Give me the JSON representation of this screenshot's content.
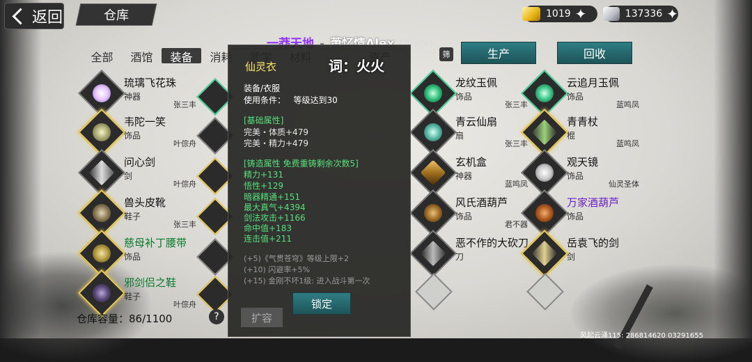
{
  "topbar": {
    "back_label": "返回",
    "title": "仓库",
    "gold": "1019",
    "silver": "137336"
  },
  "player": {
    "guild": "一莽天地",
    "dash": "-",
    "name": "萧忆情Alex",
    "alias": "(Alex)"
  },
  "tabs": [
    "全部",
    "酒馆",
    "装备",
    "消耗",
    "武学",
    "材料",
    "",
    "资产"
  ],
  "filter_icon": "筛",
  "buttons": {
    "produce": "生产",
    "recycle": "回收",
    "lock": "锁定",
    "expand": "扩容"
  },
  "ci": "词：火火",
  "capacity": {
    "label": "仓库容量：",
    "value": "86/1100"
  },
  "footer_text": "风起云涌115: 286814620 03291655",
  "tooltip": {
    "name": "仙灵衣",
    "type": "装备/衣服",
    "cond_label": "使用条件：",
    "cond_value": "等级达到30",
    "base_title": "[基础属性]",
    "base": [
      "完美・体质+479",
      "完美・精力+479"
    ],
    "forge_title": "[铸造属性  免费重铸剩余次数5]",
    "forge": [
      "精力+131",
      "悟性+129",
      "暗器精通+151",
      "最大真气+4394",
      "剑法攻击+1166",
      "命中值+183",
      "连击值+211"
    ],
    "extra": [
      "(+5)《气贯苍穹》等级上限+2",
      "(+10) 闪避率+5%",
      "(+15) 金刚不坏1级: 进入战斗第一次"
    ]
  },
  "items": [
    {
      "name": "琉璃飞花珠",
      "type": "神器",
      "owner": "张三丰",
      "color": "normal"
    },
    {
      "name": "韦陀一笑",
      "type": "饰品",
      "owner": "叶倧舟",
      "color": "normal"
    },
    {
      "name": "问心剑",
      "type": "剑",
      "owner": "叶倧舟",
      "color": "normal"
    },
    {
      "name": "兽头皮靴",
      "type": "鞋子",
      "owner": "张三丰",
      "color": "normal"
    },
    {
      "name": "慈母补丁腰带",
      "type": "饰品",
      "owner": "",
      "color": "green"
    },
    {
      "name": "邪剑侣之鞋",
      "type": "鞋子",
      "owner": "叶倧舟",
      "color": "green"
    },
    {
      "name": "龙纹玉佩",
      "type": "饰品",
      "owner": "张三丰",
      "color": "normal"
    },
    {
      "name": "青云仙扇",
      "type": "扇",
      "owner": "张三丰",
      "color": "normal"
    },
    {
      "name": "玄机盒",
      "type": "神器",
      "owner": "蓝鸣凤",
      "color": "normal"
    },
    {
      "name": "风氏酒葫芦",
      "type": "饰品",
      "owner": "君不器",
      "color": "normal"
    },
    {
      "name": "恶不作的大砍刀",
      "type": "刀",
      "owner": "",
      "color": "normal"
    },
    {
      "name": "云追月玉佩",
      "type": "饰品",
      "owner": "蓝鸣凤",
      "color": "normal"
    },
    {
      "name": "青青杖",
      "type": "棍",
      "owner": "蓝鸣凤",
      "color": "normal"
    },
    {
      "name": "观天镜",
      "type": "饰品",
      "owner": "仙灵圣体",
      "color": "normal"
    },
    {
      "name": "万家酒葫芦",
      "type": "饰品",
      "owner": "",
      "color": "purple"
    },
    {
      "name": "岳袁飞的剑",
      "type": "剑",
      "owner": "",
      "color": "normal"
    }
  ],
  "colors": {
    "accent": "#2f7d84",
    "guild": "#8f35ff",
    "green_text": "#57e07a",
    "tooltip_title": "#ffe36a"
  }
}
